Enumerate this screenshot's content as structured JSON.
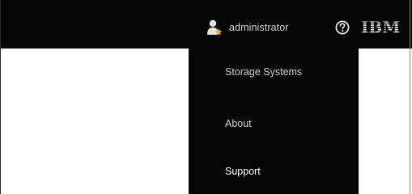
{
  "header": {
    "username": "administrator",
    "user_icon": "admin-user-icon",
    "help_icon": "help-icon",
    "logo_text": "IBM"
  },
  "user_menu": {
    "items": [
      {
        "label": "Storage Systems"
      },
      {
        "label": "About"
      },
      {
        "label": "Support"
      }
    ]
  },
  "colors": {
    "bar_background": "#050505",
    "menu_text": "#cfcfcf",
    "badge_star": "#f2b200"
  }
}
